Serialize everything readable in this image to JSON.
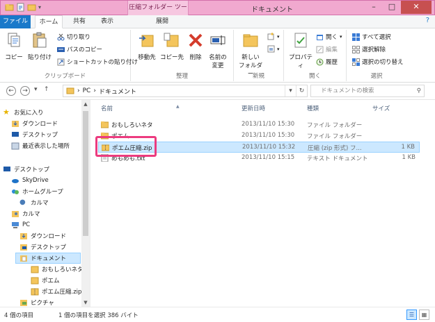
{
  "titlebar": {
    "contextual_tab_header": "圧縮フォルダー ツール",
    "window_title": "ドキュメント",
    "minimize": "–",
    "maximize": "□",
    "close": "✕"
  },
  "tabs": {
    "file": "ファイル",
    "home": "ホーム",
    "share": "共有",
    "view": "表示",
    "extract": "展開",
    "help": "?"
  },
  "ribbon": {
    "clipboard": {
      "group_label": "クリップボード",
      "copy": "コピー",
      "paste": "貼り付け",
      "cut": "切り取り",
      "copy_path": "パスのコピー",
      "paste_shortcut": "ショートカットの貼り付け"
    },
    "organize": {
      "group_label": "整理",
      "move_to": "移動先",
      "copy_to": "コピー先",
      "delete": "削除",
      "rename_line1": "名前の",
      "rename_line2": "変更"
    },
    "new": {
      "group_label": "新規",
      "new_folder_line1": "新しい",
      "new_folder_line2": "フォルダー"
    },
    "open": {
      "group_label": "開く",
      "properties": "プロパティ",
      "open": "開く",
      "edit": "編集",
      "history": "履歴"
    },
    "select": {
      "group_label": "選択",
      "select_all": "すべて選択",
      "select_none": "選択解除",
      "invert": "選択の切り替え"
    }
  },
  "address": {
    "crumbs": [
      "PC",
      "ドキュメント"
    ],
    "search_placeholder": "ドキュメントの検索"
  },
  "nav": {
    "favorites": "お気に入り",
    "fav_download": "ダウンロード",
    "fav_desktop": "デスクトップ",
    "fav_recent": "最近表示した場所",
    "desktop": "デスクトップ",
    "skydrive": "SkyDrive",
    "homegroup": "ホームグループ",
    "homegroup_user": "カルマ",
    "user": "カルマ",
    "pc": "PC",
    "pc_download": "ダウンロード",
    "pc_desktop": "デスクトップ",
    "pc_documents": "ドキュメント",
    "doc_omoshiro": "おもしろいネタ",
    "doc_poem": "ポエム",
    "doc_zip": "ポエム圧縮.zip",
    "pc_pictures": "ピクチャ"
  },
  "columns": {
    "name": "名前",
    "date": "更新日時",
    "type": "種類",
    "size": "サイズ"
  },
  "files": [
    {
      "name": "おもしろいネタ",
      "date": "2013/11/10 15:30",
      "type": "ファイル フォルダー",
      "size": ""
    },
    {
      "name": "ポエム",
      "date": "2013/11/10 15:30",
      "type": "ファイル フォルダー",
      "size": ""
    },
    {
      "name": "ポエム圧縮.zip",
      "date": "2013/11/10 15:32",
      "type": "圧縮 (zip 形式) フ...",
      "size": "1 KB"
    },
    {
      "name": "めもめも.txt",
      "date": "2013/11/10 15:15",
      "type": "テキスト ドキュメント",
      "size": "1 KB"
    }
  ],
  "status": {
    "item_count": "4 個の項目",
    "selection": "1 個の項目を選択  386 バイト"
  },
  "colors": {
    "title_bar": "#f1a9cf",
    "file_tab": "#1979ca",
    "selection": "#cce8ff",
    "highlight_box": "#ec3b7f"
  }
}
